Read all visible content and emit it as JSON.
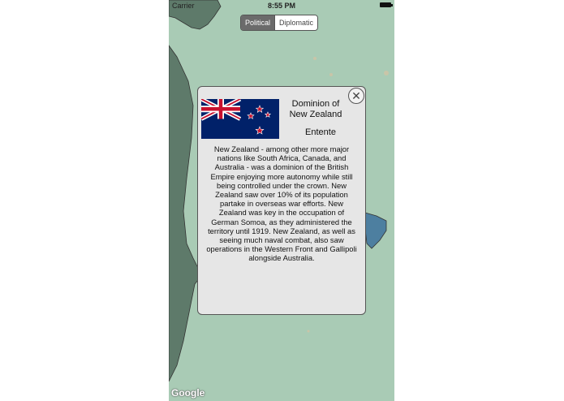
{
  "status": {
    "carrier": "Carrier",
    "time": "8:55 PM"
  },
  "segmented": {
    "political": "Political",
    "diplomatic": "Diplomatic",
    "selected": "Political"
  },
  "card": {
    "name": "Dominion of New Zealand",
    "alliance": "Entente",
    "description": "New Zealand - among other more major nations like South Africa, Canada, and Australia - was a dominion of the British Empire enjoying more autonomy while still being controlled under the crown. New Zealand saw over 10% of its population partake in overseas war efforts. New Zealand was key in the occupation of German Somoa, as they administered the territory until 1919. New Zealand, as well as seeing much naval combat, also saw operations in the Western Front and Gallipoli alongside Australia.",
    "close_icon": "close-icon",
    "flag_icon": "new-zealand-flag"
  },
  "map": {
    "attribution": "Google",
    "colors": {
      "sea": "#a9cbb5",
      "land": "#5e7a6a",
      "territory": "#4d7fa0"
    }
  }
}
